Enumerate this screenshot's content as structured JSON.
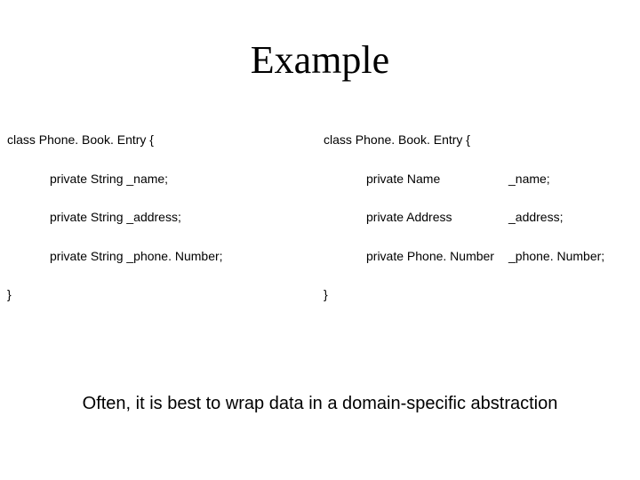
{
  "title": "Example",
  "left": {
    "header": "class Phone. Book. Entry {",
    "members": [
      "private String _name;",
      "private String _address;",
      "private String _phone. Number;"
    ],
    "close": "}"
  },
  "right": {
    "header": "class Phone. Book. Entry {",
    "rows": [
      {
        "type": "private Name",
        "var": "_name;"
      },
      {
        "type": "private Address",
        "var": "_address;"
      },
      {
        "type": "private Phone. Number",
        "var": "_phone. Number;"
      }
    ],
    "close": "}"
  },
  "conclusion": "Often, it is best to wrap data in a domain-specific abstraction"
}
